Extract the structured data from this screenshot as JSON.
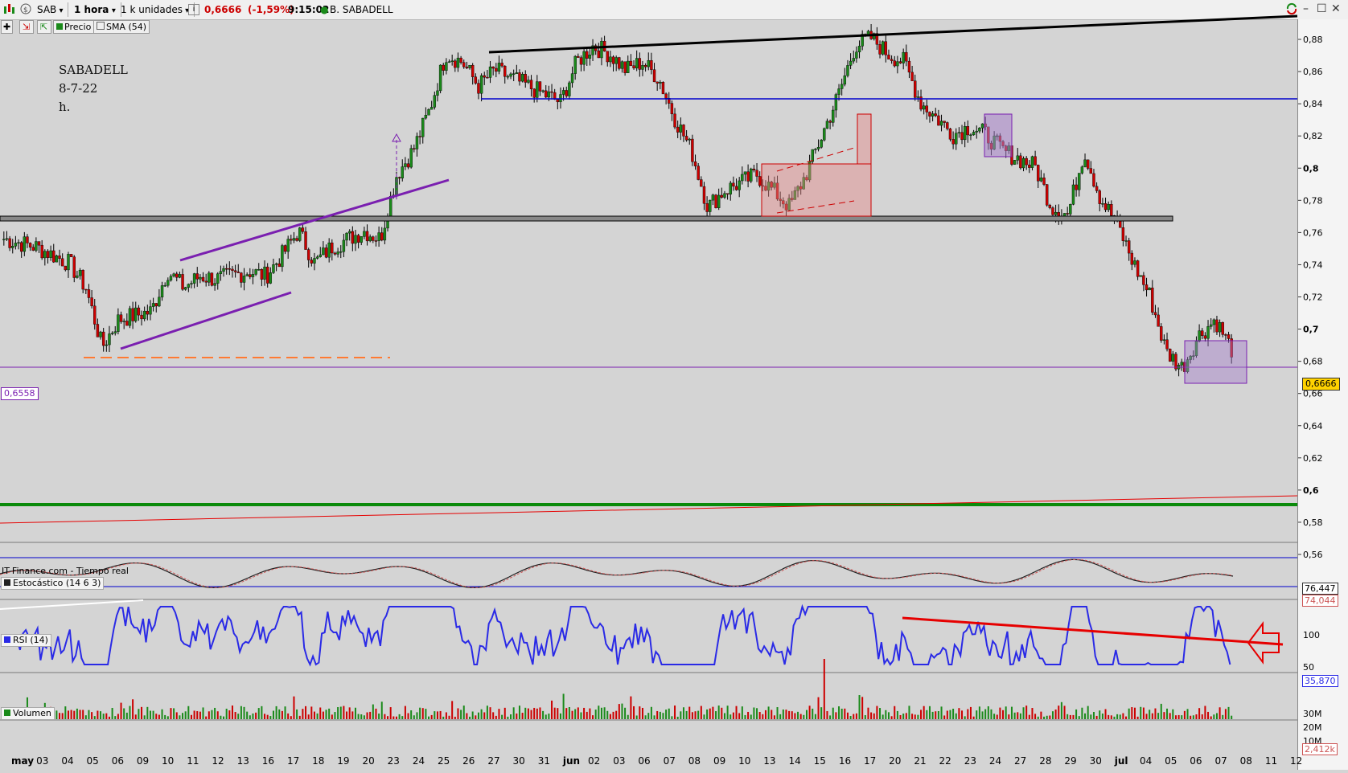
{
  "toolbar": {
    "symbol": "SAB",
    "interval": "1 hora",
    "units": "1 k unidades",
    "info_icon": "i",
    "price": "0,6666",
    "change": "(-1,59%)",
    "time": "9:15:02",
    "name": "B. SABADELL",
    "price_color": "#cc0000"
  },
  "toolbar2": {
    "price_label": "Precio",
    "sma_label": "SMA (54)"
  },
  "annotation": {
    "line1": "SABADELL",
    "line2": "8-7-22",
    "line3": "h."
  },
  "credit": "IT-Finance.com - Tiempo real",
  "panels": {
    "stoch_label": "Estocástico (14 6 3)",
    "rsi_label": "RSI (14)",
    "volume_label": "Volumen"
  },
  "labels": {
    "left_price": "0,6558",
    "current_price": "0,6666",
    "stoch_k": "76,447",
    "stoch_d": "74,044",
    "rsi_value": "35,870",
    "vol_value": "2,412k"
  },
  "chart_data": {
    "type": "candlestick",
    "y_axis_ticks": [
      "0,88",
      "0,86",
      "0,84",
      "0,82",
      "0,8",
      "0,78",
      "0,76",
      "0,74",
      "0,72",
      "0,7",
      "0,68",
      "0,66",
      "0,64",
      "0,62",
      "0,6",
      "0,58",
      "0,56"
    ],
    "x_axis_ticks": [
      "may",
      "03",
      "04",
      "05",
      "06",
      "09",
      "10",
      "11",
      "12",
      "13",
      "16",
      "17",
      "18",
      "19",
      "20",
      "23",
      "24",
      "25",
      "26",
      "27",
      "30",
      "31",
      "jun",
      "02",
      "03",
      "06",
      "07",
      "08",
      "09",
      "10",
      "13",
      "14",
      "15",
      "16",
      "17",
      "20",
      "21",
      "22",
      "23",
      "24",
      "27",
      "28",
      "29",
      "30",
      "jul",
      "04",
      "05",
      "06",
      "07",
      "08",
      "11",
      "12"
    ],
    "approx_close_path": [
      [
        0,
        0.735
      ],
      [
        2,
        0.73
      ],
      [
        4,
        0.72
      ],
      [
        5,
        0.705
      ],
      [
        6,
        0.668
      ],
      [
        7,
        0.685
      ],
      [
        9,
        0.69
      ],
      [
        10,
        0.715
      ],
      [
        11,
        0.705
      ],
      [
        12,
        0.712
      ],
      [
        13,
        0.71
      ],
      [
        15,
        0.715
      ],
      [
        16,
        0.712
      ],
      [
        17,
        0.725
      ],
      [
        18,
        0.74
      ],
      [
        19,
        0.72
      ],
      [
        20,
        0.73
      ],
      [
        22,
        0.74
      ],
      [
        23,
        0.735
      ],
      [
        24,
        0.775
      ],
      [
        25,
        0.79
      ],
      [
        26,
        0.815
      ],
      [
        27,
        0.85
      ],
      [
        28,
        0.845
      ],
      [
        29,
        0.83
      ],
      [
        30,
        0.84
      ],
      [
        31,
        0.835
      ],
      [
        32,
        0.83
      ],
      [
        33,
        0.825
      ],
      [
        34,
        0.82
      ],
      [
        35,
        0.845
      ],
      [
        36,
        0.855
      ],
      [
        37,
        0.85
      ],
      [
        38,
        0.84
      ],
      [
        39,
        0.845
      ],
      [
        40,
        0.835
      ],
      [
        41,
        0.81
      ],
      [
        42,
        0.79
      ],
      [
        43,
        0.755
      ],
      [
        44,
        0.765
      ],
      [
        45,
        0.77
      ],
      [
        46,
        0.775
      ],
      [
        47,
        0.765
      ],
      [
        48,
        0.755
      ],
      [
        49,
        0.775
      ],
      [
        50,
        0.8
      ],
      [
        51,
        0.825
      ],
      [
        52,
        0.855
      ],
      [
        53,
        0.86
      ],
      [
        54,
        0.85
      ],
      [
        55,
        0.845
      ],
      [
        56,
        0.82
      ],
      [
        57,
        0.81
      ],
      [
        58,
        0.8
      ],
      [
        59,
        0.805
      ],
      [
        60,
        0.8
      ],
      [
        61,
        0.79
      ],
      [
        62,
        0.785
      ],
      [
        63,
        0.78
      ],
      [
        64,
        0.755
      ],
      [
        65,
        0.75
      ],
      [
        66,
        0.79
      ],
      [
        67,
        0.76
      ],
      [
        68,
        0.745
      ],
      [
        69,
        0.72
      ],
      [
        70,
        0.7
      ],
      [
        71,
        0.665
      ],
      [
        72,
        0.655
      ],
      [
        73,
        0.675
      ],
      [
        74,
        0.685
      ],
      [
        75,
        0.6666
      ]
    ],
    "horizontal_lines": {
      "resistance_blue": 0.822,
      "support_black": 0.748,
      "purple_line": 0.6558
    },
    "ylim": [
      0.55,
      0.89
    ],
    "stochastic": {
      "k": 76.447,
      "d": 74.044
    },
    "rsi": {
      "value": 35.87,
      "ticks": [
        "100",
        "50"
      ]
    },
    "volume_ticks": [
      "30M",
      "20M",
      "10M"
    ]
  },
  "colors": {
    "bg": "#d4d4d4",
    "candle": "#000000",
    "blue_line": "#0000cc",
    "purple": "#7a1fb0",
    "red": "#e60000",
    "green": "#0a8a0a"
  }
}
